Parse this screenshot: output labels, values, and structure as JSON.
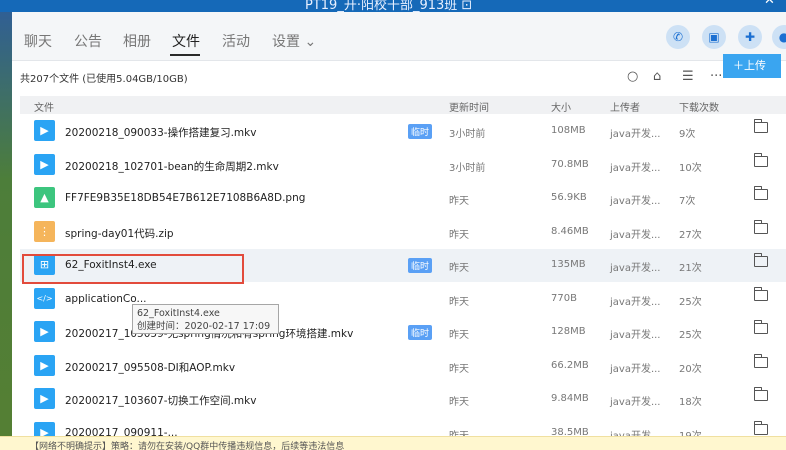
{
  "window": {
    "title": "PT19_开·阳校干部_913班 ⊡",
    "close_glyph": "✕"
  },
  "tabs": [
    "聊天",
    "公告",
    "相册",
    "文件",
    "活动",
    "设置 ⌄"
  ],
  "nav_icons": [
    "phone-icon",
    "video-icon",
    "share-screen-icon",
    "more-icon"
  ],
  "summary": "共207个文件 (已使用5.04GB/10GB)",
  "toolbar": {
    "upload_label": "上传"
  },
  "columns": {
    "name": "文件",
    "updated": "更新时间",
    "size": "大小",
    "uploader": "上传者",
    "downloads": "下载次数"
  },
  "temp_label": "临时",
  "files": [
    {
      "name": "20200218_090033-操作搭建复习.mkv",
      "icon": "video-icon",
      "icon_color": "#2aa4f4",
      "temp": true,
      "updated": "3小时前",
      "size": "108MB",
      "uploader": "java开发...",
      "downloads": "9次"
    },
    {
      "name": "20200218_102701-bean的生命周期2.mkv",
      "icon": "video-icon",
      "icon_color": "#2aa4f4",
      "temp": false,
      "updated": "3小时前",
      "size": "70.8MB",
      "uploader": "java开发...",
      "downloads": "10次"
    },
    {
      "name": "FF7FE9B35E18DB54E7B612E7108B6A8D.png",
      "icon": "image-icon",
      "icon_color": "#3cc57e",
      "temp": false,
      "updated": "昨天",
      "size": "56.9KB",
      "uploader": "java开发...",
      "downloads": "7次"
    },
    {
      "name": "spring-day01代码.zip",
      "icon": "zip-icon",
      "icon_color": "#f5b55b",
      "temp": false,
      "updated": "昨天",
      "size": "8.46MB",
      "uploader": "java开发...",
      "downloads": "27次"
    },
    {
      "name": "62_FoxitInst4.exe",
      "icon": "windows-icon",
      "icon_color": "#2aa4f4",
      "temp": true,
      "updated": "昨天",
      "size": "135MB",
      "uploader": "java开发...",
      "downloads": "21次",
      "selected": true
    },
    {
      "name": "applicationCo...",
      "icon": "code-icon",
      "icon_color": "#2aa4f4",
      "temp": false,
      "updated": "昨天",
      "size": "770B",
      "uploader": "java开发...",
      "downloads": "25次"
    },
    {
      "name": "20200217_105059-无spring情况和有spring环境搭建.mkv",
      "icon": "video-icon",
      "icon_color": "#2aa4f4",
      "temp": true,
      "updated": "昨天",
      "size": "128MB",
      "uploader": "java开发...",
      "downloads": "25次"
    },
    {
      "name": "20200217_095508-DI和AOP.mkv",
      "icon": "video-icon",
      "icon_color": "#2aa4f4",
      "temp": false,
      "updated": "昨天",
      "size": "66.2MB",
      "uploader": "java开发...",
      "downloads": "20次"
    },
    {
      "name": "20200217_103607-切换工作空间.mkv",
      "icon": "video-icon",
      "icon_color": "#2aa4f4",
      "temp": false,
      "updated": "昨天",
      "size": "9.84MB",
      "uploader": "java开发...",
      "downloads": "18次"
    },
    {
      "name": "20200217_090911-...",
      "icon": "video-icon",
      "icon_color": "#2aa4f4",
      "temp": false,
      "updated": "昨天",
      "size": "38.5MB",
      "uploader": "java开发...",
      "downloads": "19次"
    }
  ],
  "tooltip": {
    "line1": "62_FoxitInst4.exe",
    "line2": "创建时间：2020-02-17 17:09"
  },
  "footer_notice": "【网络不明确提示】策略：请勿在安装/QQ群中传播违规信息，后续等违法信息",
  "colors": {
    "accent": "#3aa5f0",
    "selection_box": "#e24b3c",
    "temp_badge": "#5aa0f5"
  }
}
